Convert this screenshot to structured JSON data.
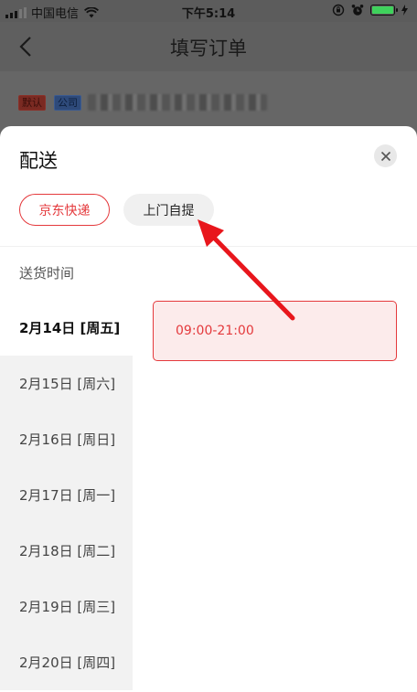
{
  "status_bar": {
    "carrier": "中国电信",
    "time": "下午5:14",
    "battery_level": 1.0
  },
  "nav": {
    "title": "填写订单",
    "back_icon": "chevron-left-icon"
  },
  "address": {
    "tag_default": "默认",
    "tag_company": "公司"
  },
  "sheet": {
    "title": "配送",
    "close_icon": "close-icon",
    "methods": [
      "京东快递",
      "上门自提"
    ],
    "selected_method": "京东快递",
    "section_label": "送货时间",
    "dates": [
      "2月14日 [周五]",
      "2月15日 [周六]",
      "2月16日 [周日]",
      "2月17日 [周一]",
      "2月18日 [周二]",
      "2月19日 [周三]",
      "2月20日 [周四]"
    ],
    "selected_date": "2月14日 [周五]",
    "time_slot": "09:00-21:00"
  },
  "colors": {
    "accent": "#e4393c",
    "annotation_arrow": "#e8161c"
  }
}
